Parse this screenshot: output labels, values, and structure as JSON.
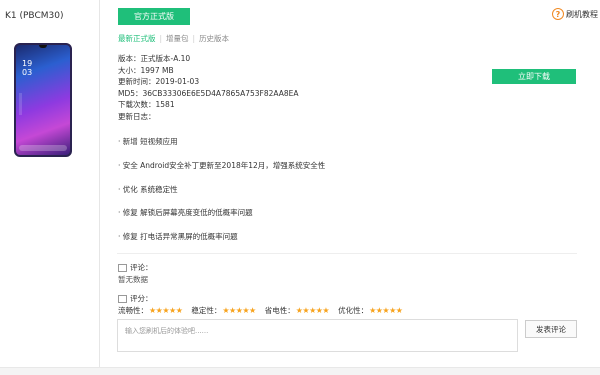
{
  "device": {
    "name": "K1 (PBCM30)",
    "screen_time": "19\n03"
  },
  "header": {
    "version_button": "官方正式版",
    "help_label": "刷机教程",
    "help_icon": "question-icon"
  },
  "tabs": [
    {
      "label": "最新正式版",
      "active": true
    },
    {
      "label": "增量包",
      "active": false
    },
    {
      "label": "历史版本",
      "active": false
    }
  ],
  "info": {
    "version": "版本：正式版本-A.10",
    "size": "大小：1997 MB",
    "date": "更新时间：2019-01-03",
    "md5": "MD5：36CB33306E6E5D4A7865A753F82AA8EA",
    "downloads": "下载次数：1581",
    "changelog_title": "更新日志："
  },
  "download_button": "立即下载",
  "changelog": [
    "· 新增 短视频应用",
    "· 安全 Android安全补丁更新至2018年12月，增强系统安全性",
    "· 优化 系统稳定性",
    "· 修复 解锁后屏幕亮度变低的低概率问题",
    "· 修复 打电话异常黑屏的低概率问题"
  ],
  "comments": {
    "title": "评论：",
    "empty": "暂无数据",
    "icon": "comment-icon"
  },
  "rating": {
    "title": "评分：",
    "icon": "rating-icon",
    "items": [
      {
        "label": "流畅性：",
        "stars": "★★★★★",
        "value": 5
      },
      {
        "label": "稳定性：",
        "stars": "★★★★★",
        "value": 5
      },
      {
        "label": "省电性：",
        "stars": "★★★★★",
        "value": 5
      },
      {
        "label": "优化性：",
        "stars": "★★★★★",
        "value": 5
      }
    ]
  },
  "comment_input": {
    "placeholder": "输入您刷机后的体验吧......",
    "value": ""
  },
  "submit_button": "发表评论",
  "colors": {
    "accent": "#1fbf7a",
    "star": "#f7a21b",
    "help": "#f08a24"
  }
}
